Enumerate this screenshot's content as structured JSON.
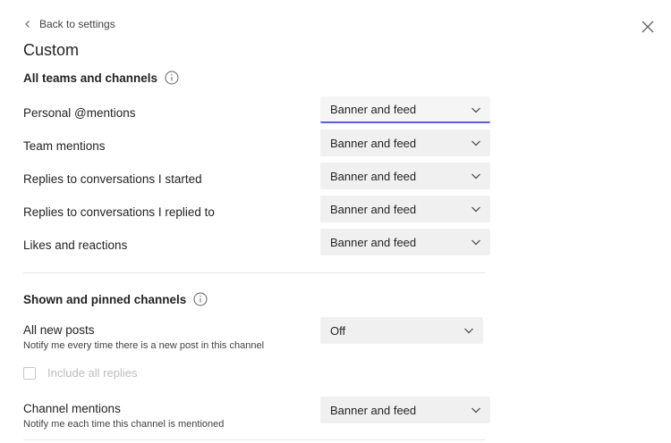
{
  "header": {
    "back_label": "Back to settings",
    "title": "Custom"
  },
  "section_all": {
    "heading": "All teams and channels",
    "rows": [
      {
        "label": "Personal @mentions",
        "value": "Banner and feed"
      },
      {
        "label": "Team mentions",
        "value": "Banner and feed"
      },
      {
        "label": "Replies to conversations I started",
        "value": "Banner and feed"
      },
      {
        "label": "Replies to conversations I replied to",
        "value": "Banner and feed"
      },
      {
        "label": "Likes and reactions",
        "value": "Banner and feed"
      }
    ]
  },
  "section_channels": {
    "heading": "Shown and pinned channels",
    "all_new_posts": {
      "label": "All new posts",
      "description": "Notify me every time there is a new post in this channel",
      "value": "Off"
    },
    "include_replies": {
      "label": "Include all replies",
      "checked": false
    },
    "channel_mentions": {
      "label": "Channel mentions",
      "description": "Notify me each time this channel is mentioned",
      "value": "Banner and feed"
    }
  },
  "icons": {
    "back": "chevron-left-icon",
    "close": "close-icon",
    "info": "info-icon",
    "caret": "chevron-down-icon"
  },
  "colors": {
    "focus_accent": "#5b5fc7",
    "dropdown_bg": "#f0f0f0"
  }
}
